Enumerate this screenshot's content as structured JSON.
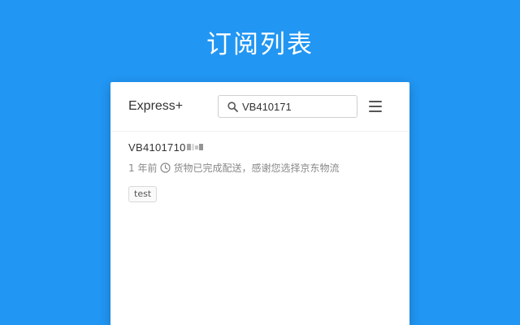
{
  "page": {
    "title": "订阅列表"
  },
  "header": {
    "brand": "Express+",
    "search": {
      "value": "VB410171",
      "placeholder": ""
    }
  },
  "items": [
    {
      "tracking_number": "VB4101710",
      "time_ago": "1 年前",
      "status": "货物已完成配送，感谢您选择京东物流",
      "tag": "test"
    }
  ],
  "icons": {
    "search": "search-icon",
    "menu": "menu-icon",
    "clock": "clock-icon"
  },
  "colors": {
    "background": "#2196f3",
    "card": "#ffffff",
    "text_primary": "#333333",
    "text_secondary": "#888888"
  }
}
